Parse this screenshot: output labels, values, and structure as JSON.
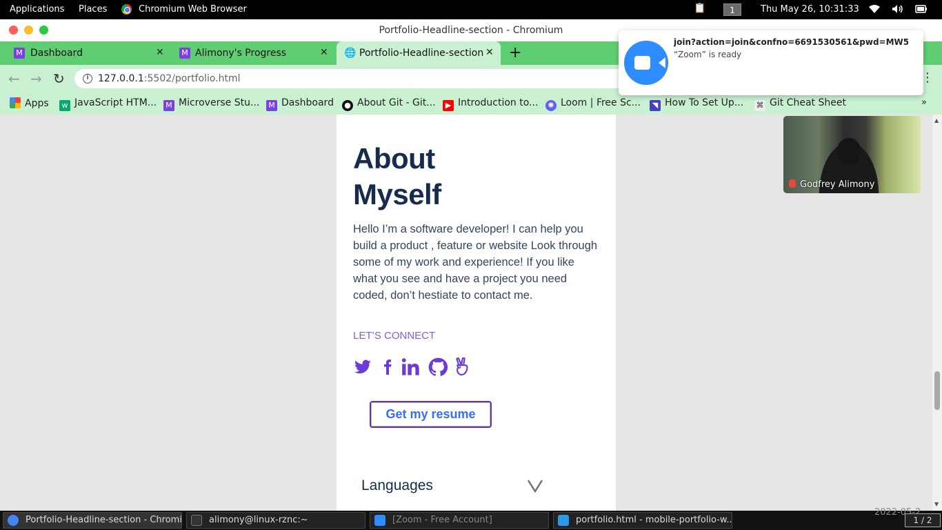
{
  "top_panel": {
    "applications": "Applications",
    "places": "Places",
    "active_app": "Chromium Web Browser",
    "workspace": "1",
    "clock": "Thu May 26, 10:31:33"
  },
  "window": {
    "title": "Portfolio-Headline-section - Chromium"
  },
  "tabs": [
    {
      "label": "Dashboard"
    },
    {
      "label": "Alimony's Progress"
    },
    {
      "label": "Portfolio-Headline-section"
    }
  ],
  "address_bar": {
    "host": "127.0.0.1",
    "path": ":5502/portfolio.html"
  },
  "bookmarks": [
    {
      "label": "Apps",
      "icon": "apps-grid-icon"
    },
    {
      "label": "JavaScript HTM...",
      "icon": "w3schools-icon"
    },
    {
      "label": "Microverse Stu...",
      "icon": "microverse-icon"
    },
    {
      "label": "Dashboard",
      "icon": "microverse-icon"
    },
    {
      "label": "About Git - Git...",
      "icon": "github-icon"
    },
    {
      "label": "Introduction to...",
      "icon": "youtube-icon"
    },
    {
      "label": "Loom | Free Sc...",
      "icon": "loom-icon"
    },
    {
      "label": "How To Set Up...",
      "icon": "bookmark-icon"
    },
    {
      "label": "Git Cheat Sheet",
      "icon": "command-icon"
    }
  ],
  "page": {
    "about_title_line1": "About",
    "about_title_line2": "Myself",
    "about_text": "Hello I’m a software developer! I can help you build a product , feature or website Look through some of my work and experience! If you like what you see and have a project you need coded, don’t hestiate to contact me.",
    "lets_connect": "LET’S CONNECT",
    "social_icons": [
      "twitter-icon",
      "facebook-icon",
      "linkedin-icon",
      "github-icon",
      "angellist-icon"
    ],
    "resume_button": "Get my resume",
    "languages_label": "Languages"
  },
  "notification": {
    "title": "join?action=join&confno=6691530561&pwd=MW5H...",
    "body": "“Zoom” is ready"
  },
  "video": {
    "participant": "Godfrey Alimony"
  },
  "taskbar": {
    "items": [
      {
        "label": "Portfolio-Headline-section - Chromi..."
      },
      {
        "label": "alimony@linux-rznc:~"
      },
      {
        "label": "[Zoom - Free Account]"
      },
      {
        "label": "portfolio.html - mobile-portfolio-w..."
      }
    ],
    "date_partial": "2022-05-2",
    "pager": "1 / 2"
  },
  "colors": {
    "tab_strip": "#5fce73",
    "toolbar": "#c9f0d0",
    "heading": "#172b4d",
    "accent_purple": "#7f5cf1",
    "button_text": "#396df2"
  }
}
